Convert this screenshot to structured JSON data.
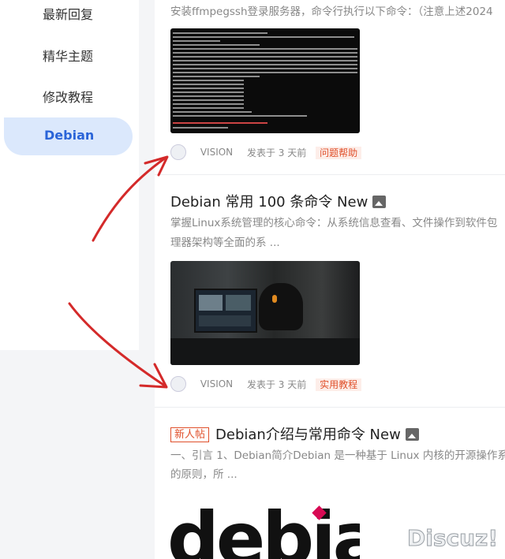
{
  "sidebar": {
    "items": [
      {
        "label": "最新回复"
      },
      {
        "label": "精华主题"
      },
      {
        "label": "修改教程"
      },
      {
        "label": "Debian",
        "active": true
      }
    ]
  },
  "posts": [
    {
      "excerpt": "安装ffmpegssh登录服务器，命令行执行以下命令：（注意上述2024",
      "image": "terminal-screenshot",
      "user": "VISION",
      "time": "发表于 3 天前",
      "tag": "问题帮助"
    },
    {
      "title": "Debian 常用 100 条命令 New",
      "excerpt_lines": [
        "掌握Linux系统管理的核心命令：从系统信息查看、文件操作到软件包",
        "理器架构等全面的系 ..."
      ],
      "image": "video-editing-photo",
      "user": "VISION",
      "time": "发表于 3 天前",
      "tag": "实用教程"
    },
    {
      "badge": "新人帖",
      "title": "Debian介绍与常用命令 New",
      "excerpt_lines": [
        "一、引言 1、Debian简介Debian 是一种基于 Linux 内核的开源操作系",
        "的原则，所 ..."
      ],
      "image": "debian-logo",
      "image_text": "debia"
    }
  ],
  "watermark": "Discuz!",
  "colors": {
    "accent": "#2a64d8",
    "tag": "#e0502b",
    "annotation": "#d42a2a"
  }
}
